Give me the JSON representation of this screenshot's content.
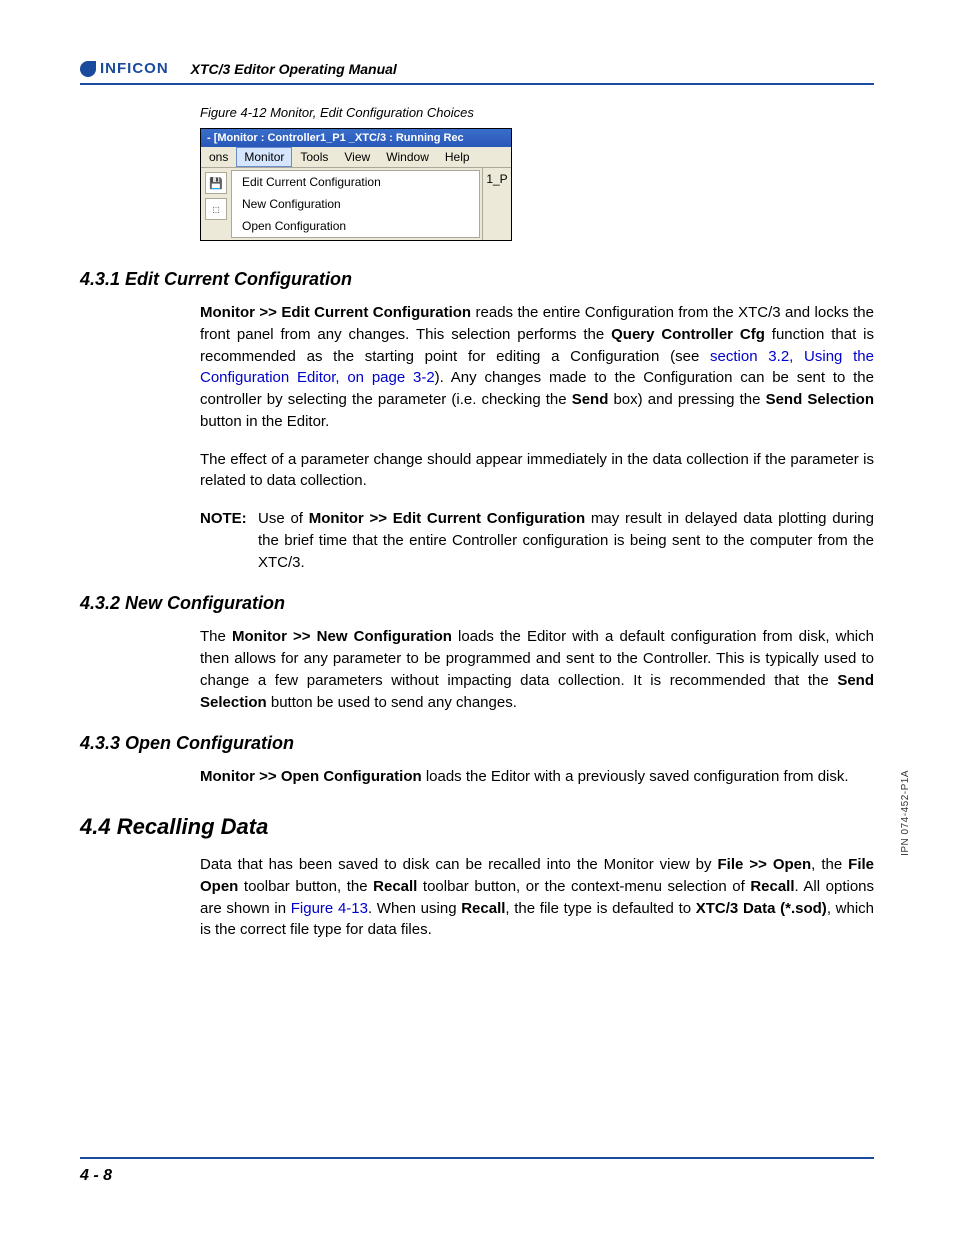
{
  "header": {
    "logo_text": "INFICON",
    "manual_title": "XTC/3 Editor Operating Manual"
  },
  "figure": {
    "caption": "Figure 4-12  Monitor, Edit Configuration Choices",
    "title_bar": "- [Monitor : Controller1_P1 _XTC/3 : Running Rec",
    "menu": {
      "ons": "ons",
      "monitor": "Monitor",
      "tools": "Tools",
      "view": "View",
      "window": "Window",
      "help": "Help"
    },
    "dropdown": {
      "edit": "Edit Current Configuration",
      "new": "New Configuration",
      "open": "Open Configuration"
    },
    "right_slot": "1_P"
  },
  "sections": {
    "s431": {
      "heading": "4.3.1  Edit Current Configuration",
      "p1_a": "Monitor >> Edit Current Configuration",
      "p1_b": " reads the entire Configuration from the XTC/3 and locks the front panel from any changes. This selection performs the ",
      "p1_c": "Query Controller Cfg",
      "p1_d": " function that is recommended as the starting point for editing a Configuration (see ",
      "p1_link": "section 3.2, Using the Configuration Editor, on page 3-2",
      "p1_e": "). Any changes made to the Configuration can be sent to the controller by selecting the parameter (i.e. checking the ",
      "p1_f": "Send",
      "p1_g": " box) and pressing the ",
      "p1_h": "Send Selection",
      "p1_i": " button in the Editor.",
      "p2": "The effect of a parameter change should appear immediately in the data collection if the parameter is related to data collection.",
      "note_label": "NOTE:",
      "note_a": "Use of ",
      "note_b": "Monitor >> Edit Current Configuration",
      "note_c": " may result in delayed data plotting during the brief time that the entire Controller configuration is being sent to the computer from the XTC/3."
    },
    "s432": {
      "heading": "4.3.2  New Configuration",
      "p1_a": "The ",
      "p1_b": "Monitor >> New Configuration",
      "p1_c": " loads the Editor with a default configuration from disk, which then allows for any parameter to be programmed and sent to the Controller. This is typically used to change a few parameters without impacting data collection. It is recommended that the ",
      "p1_d": "Send Selection",
      "p1_e": " button be used to send any changes."
    },
    "s433": {
      "heading": "4.3.3  Open Configuration",
      "p1_a": "Monitor >> Open Configuration",
      "p1_b": " loads the Editor with a previously saved configuration from disk."
    },
    "s44": {
      "heading": "4.4  Recalling Data",
      "p1_a": "Data that has been saved to disk can be recalled into the Monitor view by ",
      "p1_b": "File >> Open",
      "p1_c": ", the ",
      "p1_d": "File Open",
      "p1_e": " toolbar button, the ",
      "p1_f": "Recall",
      "p1_g": " toolbar button, or the context-menu selection of ",
      "p1_h": "Recall",
      "p1_i": ". All options are shown in ",
      "p1_link": "Figure 4-13",
      "p1_j": ". When using ",
      "p1_k": "Recall",
      "p1_l": ", the file type is defaulted to ",
      "p1_m": "XTC/3 Data (*.sod)",
      "p1_n": ", which is the correct file type for data files."
    }
  },
  "side_text": "IPN 074-452-P1A",
  "footer": "4 - 8"
}
